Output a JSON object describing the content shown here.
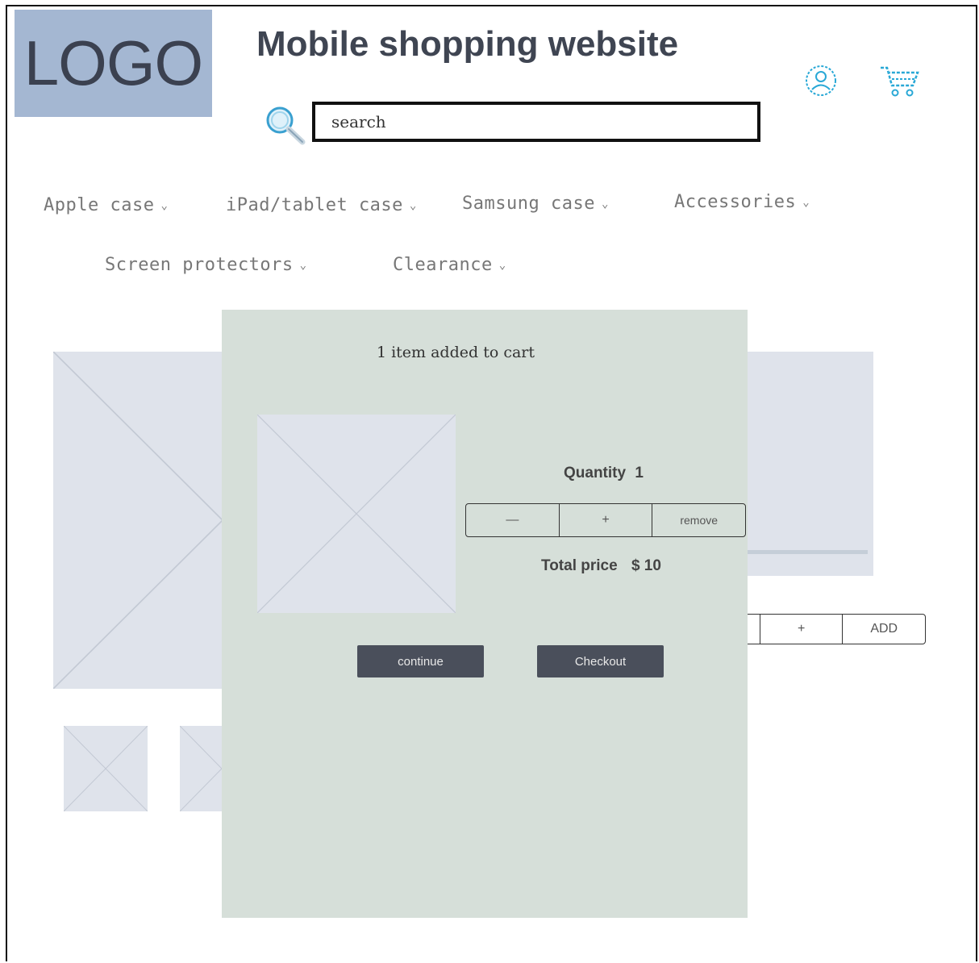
{
  "header": {
    "logo_text": "LOGO",
    "site_title": "Mobile shopping website",
    "search": {
      "placeholder": "search",
      "icon": "search-icon"
    },
    "icons": {
      "account": "user-icon",
      "cart": "cart-icon"
    }
  },
  "nav": {
    "items": [
      {
        "label": "Apple case"
      },
      {
        "label": "iPad/tablet case"
      },
      {
        "label": "Samsung case"
      },
      {
        "label": "Accessories"
      },
      {
        "label": "Screen protectors"
      },
      {
        "label": "Clearance"
      }
    ],
    "chevron": "⌄"
  },
  "background_product": {
    "stepper": {
      "plus": "+",
      "add": "ADD"
    }
  },
  "modal": {
    "title": "1 item added to cart",
    "quantity_label": "Quantity",
    "quantity_value": "1",
    "stepper": {
      "minus": "—",
      "plus": "+",
      "remove": "remove"
    },
    "total_label": "Total price",
    "total_value": "$ 10",
    "continue_label": "continue",
    "checkout_label": "Checkout"
  },
  "colors": {
    "logo_bg": "#a4b7d2",
    "modal_bg": "#d6dfd9",
    "button_bg": "#4a4f5b",
    "placeholder_bg": "#dfe3eb",
    "icon_accent": "#29a8d6"
  }
}
